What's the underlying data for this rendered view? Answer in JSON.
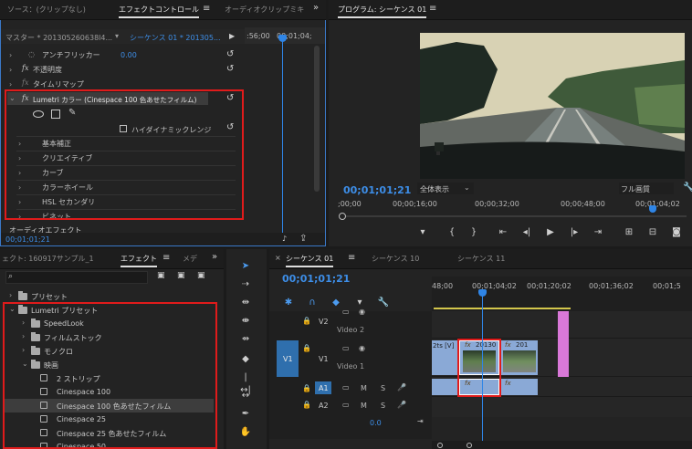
{
  "effect_controls": {
    "tabs": [
      "ソース：(クリップなし)",
      "エフェクトコントロール",
      "オーディオクリップミキ"
    ],
    "master_label": "マスター * 201305260638l4...",
    "sequence_label": "シーケンス 01 * 201305...",
    "ruler_times": [
      ":56;00",
      "00;01;04;"
    ],
    "properties": [
      {
        "name": "アンチフリッカー",
        "value": "0.00"
      },
      {
        "name": "不透明度"
      },
      {
        "name": "タイムリマップ"
      }
    ],
    "lumetri_title": "Lumetri カラー (Cinespace 100 色あせたフィルム)",
    "hdr_label": "ハイダイナミックレンジ",
    "sections": [
      "基本補正",
      "クリエイティブ",
      "カーブ",
      "カラーホイール",
      "HSL セカンダリ",
      "ビネット"
    ],
    "audio_effects": "オーディオエフェクト",
    "current_time": "00;01;01;21"
  },
  "program": {
    "tab": "プログラム: シーケンス 01",
    "timecode": "00;01;01;21",
    "fit": "全体表示",
    "quality": "フル画質",
    "ruler_times": [
      ";00;00",
      "00;00;16;00",
      "00;00;32;00",
      "00;00;48;00",
      "00;01;04;02"
    ]
  },
  "effects_panel": {
    "tabs": [
      "ェクト: 160917サンプル_1",
      "エフェクト",
      "メデ"
    ],
    "items": [
      {
        "label": "プリセット",
        "level": 0,
        "kind": "folder"
      },
      {
        "label": "Lumetri プリセット",
        "level": 0,
        "kind": "folder",
        "open": true
      },
      {
        "label": "SpeedLook",
        "level": 1,
        "kind": "folder"
      },
      {
        "label": "フィルムストック",
        "level": 1,
        "kind": "folder"
      },
      {
        "label": "モノクロ",
        "level": 1,
        "kind": "folder"
      },
      {
        "label": "映画",
        "level": 1,
        "kind": "folder",
        "open": true
      },
      {
        "label": "2 ストリップ",
        "level": 2,
        "kind": "preset"
      },
      {
        "label": "Cinespace 100",
        "level": 2,
        "kind": "preset"
      },
      {
        "label": "Cinespace 100 色あせたフィルム",
        "level": 2,
        "kind": "preset",
        "selected": true
      },
      {
        "label": "Cinespace 25",
        "level": 2,
        "kind": "preset"
      },
      {
        "label": "Cinespace 25 色あせたフィルム",
        "level": 2,
        "kind": "preset"
      },
      {
        "label": "Cinespace 50",
        "level": 2,
        "kind": "preset"
      }
    ]
  },
  "timeline": {
    "tabs": [
      "シーケンス 01",
      "シーケンス 10",
      "シーケンス 11"
    ],
    "timecode": "00;01;01;21",
    "ruler_times": [
      "48;00",
      "00;01;04;02",
      "00;01;20;02",
      "00;01;36;02",
      "00;01;5"
    ],
    "tracks": [
      {
        "id": "V2",
        "name": "Video 2"
      },
      {
        "id": "V1",
        "name": "Video 1"
      },
      {
        "id": "A1"
      },
      {
        "id": "A2"
      }
    ],
    "track_buttons": [
      "M",
      "S"
    ],
    "volume": "0.0",
    "clip_labels": [
      "2ts [V]",
      "20130",
      "201"
    ]
  },
  "colors": {
    "accent": "#3d8ee8",
    "highlight": "#e01b1b",
    "clip_blue": "#8aa9d6",
    "clip_pink": "#d978d8"
  }
}
